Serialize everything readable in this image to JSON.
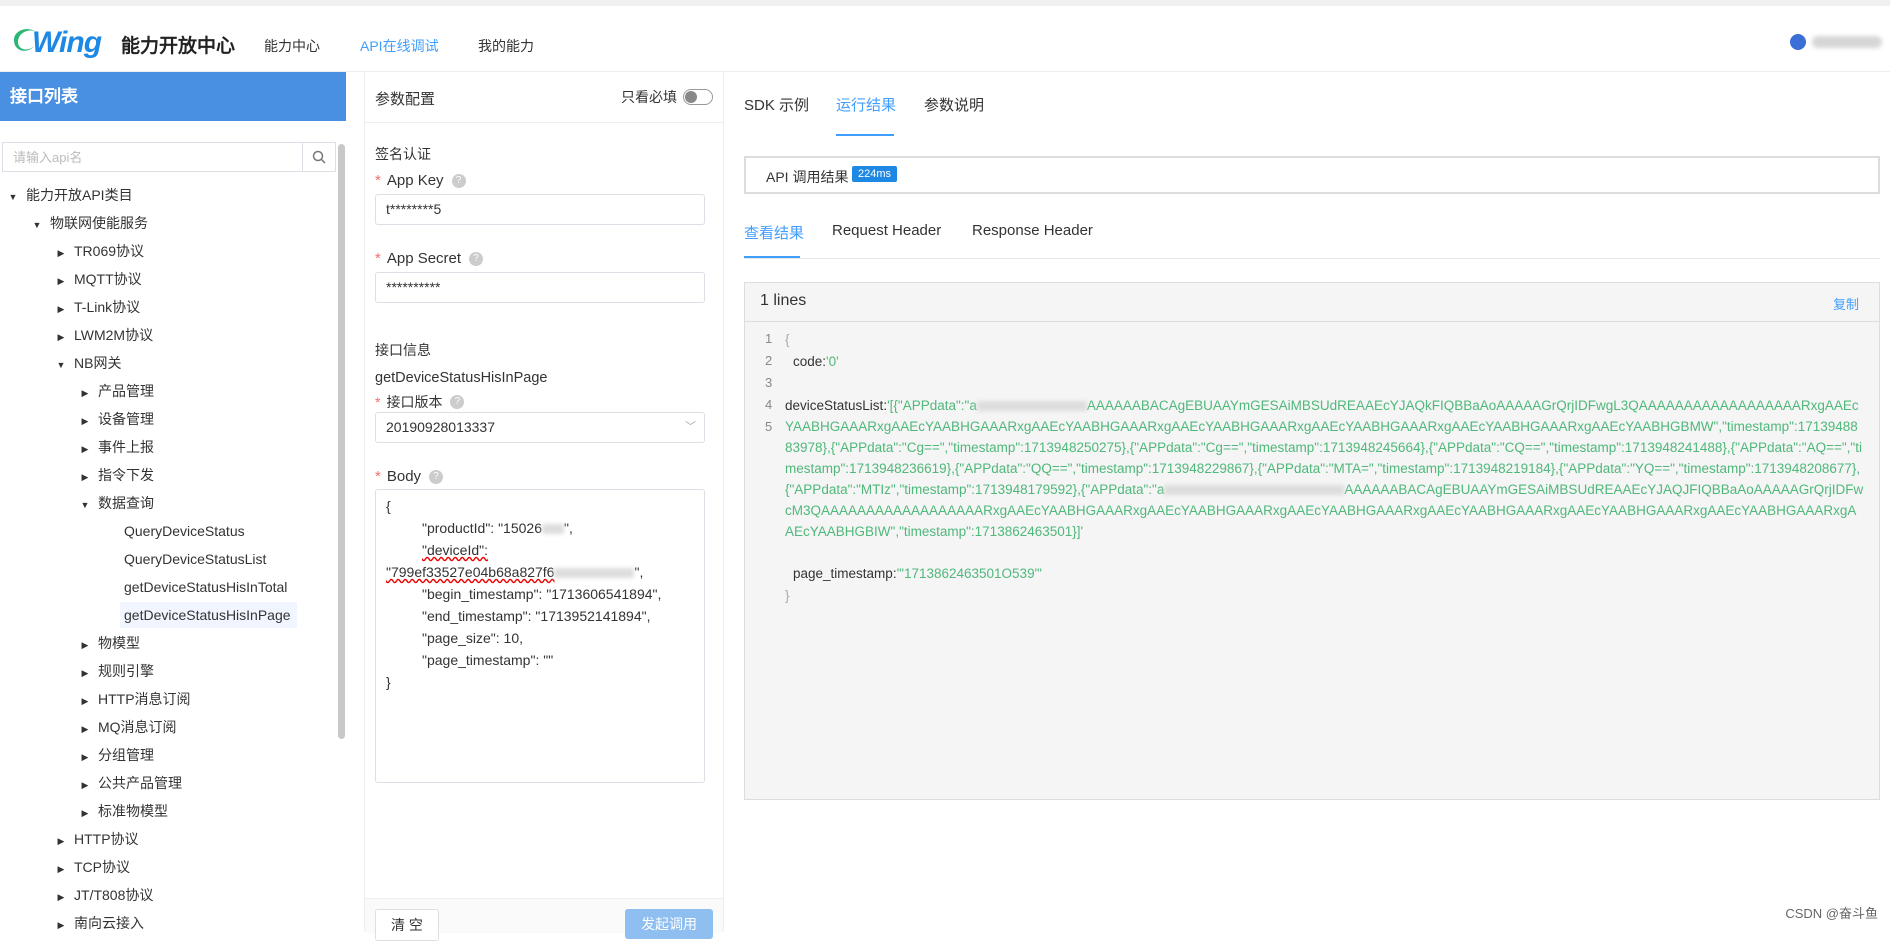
{
  "header": {
    "logo_text": "Wing",
    "app_title": "能力开放中心",
    "nav": [
      "能力中心",
      "API在线调试",
      "我的能力"
    ],
    "active_nav": "API在线调试"
  },
  "sidebar": {
    "title": "接口列表",
    "search_placeholder": "请输入api名",
    "tree": {
      "root": "能力开放API类目",
      "group": "物联网使能服务",
      "items": [
        "TR069协议",
        "MQTT协议",
        "T-Link协议",
        "LWM2M协议",
        "NB网关"
      ],
      "nb_children": [
        "产品管理",
        "设备管理",
        "事件上报",
        "指令下发",
        "数据查询"
      ],
      "data_query_children": [
        "QueryDeviceStatus",
        "QueryDeviceStatusList",
        "getDeviceStatusHisInTotal",
        "getDeviceStatusHisInPage"
      ],
      "nb_more": [
        "物模型",
        "规则引擎",
        "HTTP消息订阅",
        "MQ消息订阅",
        "分组管理",
        "公共产品管理",
        "标准物模型"
      ],
      "bottom_items": [
        "HTTP协议",
        "TCP协议",
        "JT/T808协议",
        "南向云接入"
      ]
    }
  },
  "params": {
    "title": "参数配置",
    "required_only": "只看必填",
    "auth_section": "签名认证",
    "app_key_label": "App Key",
    "app_key_value": "t********5",
    "app_secret_label": "App Secret",
    "app_secret_value": "**********",
    "api_section": "接口信息",
    "api_name": "getDeviceStatusHisInPage",
    "version_label": "接口版本",
    "version_value": "20190928013337",
    "body_label": "Body",
    "body_lines": {
      "open": "{",
      "product": "\"productId\": \"15026",
      "product_end": "\",",
      "device_key": "\"deviceId\":",
      "device_val": "\"799ef33527e04b68a827f6",
      "device_end": "\",",
      "begin": "\"begin_timestamp\": \"1713606541894\",",
      "end": "\"end_timestamp\": \"1713952141894\",",
      "size": "\"page_size\": 10,",
      "page": "\"page_timestamp\": \"\"",
      "close": "}"
    },
    "clear_button": "清 空",
    "send_button": "发起调用"
  },
  "result": {
    "tabs": [
      "SDK 示例",
      "运行结果",
      "参数说明"
    ],
    "active_tab": "运行结果",
    "call_label": "API 调用结果",
    "call_time": "224ms",
    "subtabs": [
      "查看结果",
      "Request Header",
      "Response Header"
    ],
    "active_subtab": "查看结果",
    "lines_label": "1 lines",
    "copy_label": "复制",
    "line_numbers": [
      "1",
      "2",
      "3",
      "4",
      "5"
    ],
    "code": {
      "open_brace": "{",
      "code_key": "code",
      "code_val": "'0'",
      "device_key": "deviceStatusList",
      "device_val_a": "'[{\"APPdata\":\"a",
      "device_val_b": "AAAAAABACAgEBUAAYmGESAiMBSUdREAAEcYJAQkFIQBBaAoAAAAAGrQrjIDFwgL3QAAAAAAAAAAAAAAAAAARxgAAEcYAABHGAAARxgAAEcYAABHGAAARxgAAEcYAABHGAAARxgAAEcYAABHGAAARxgAAEcYAABHGAAARxgAAEcYAABHGAAARxgAAEcYAABHGBMW\",\"timestamp\":1713948883978},{\"APPdata\":\"Cg==\",\"timestamp\":1713948250275},{\"APPdata\":\"Cg==\",\"timestamp\":1713948245664},{\"APPdata\":\"CQ==\",\"timestamp\":1713948241488},{\"APPdata\":\"AQ==\",\"timestamp\":1713948236619},{\"APPdata\":\"QQ==\",\"timestamp\":1713948229867},{\"APPdata\":\"MTA=\",\"timestamp\":1713948219184},{\"APPdata\":\"YQ==\",\"timestamp\":1713948208677},{\"APPdata\":\"MTIz\",\"timestamp\":1713948179592},{\"APPdata\":\"a",
      "device_val_c": "AAAAAABACAgEBUAAYmGESAiMBSUdREAAEcYJAQJFIQBBaAoAAAAAGrQrjIDFwcM3QAAAAAAAAAAAAAAAAAARxgAAEcYAABHGAAARxgAAEcYAABHGAAARxgAAEcYAABHGAAARxgAAEcYAABHGAAARxgAAEcYAABHGAAARxgAAEcYAABHGAAARxgAAEcYAABHGBIW\",\"timestamp\":1713862463501}]'",
      "page_key": "page_timestamp",
      "page_val": "'\"1713862463501O539\"'",
      "close_brace": "}"
    }
  },
  "watermark": "CSDN @奋斗鱼"
}
